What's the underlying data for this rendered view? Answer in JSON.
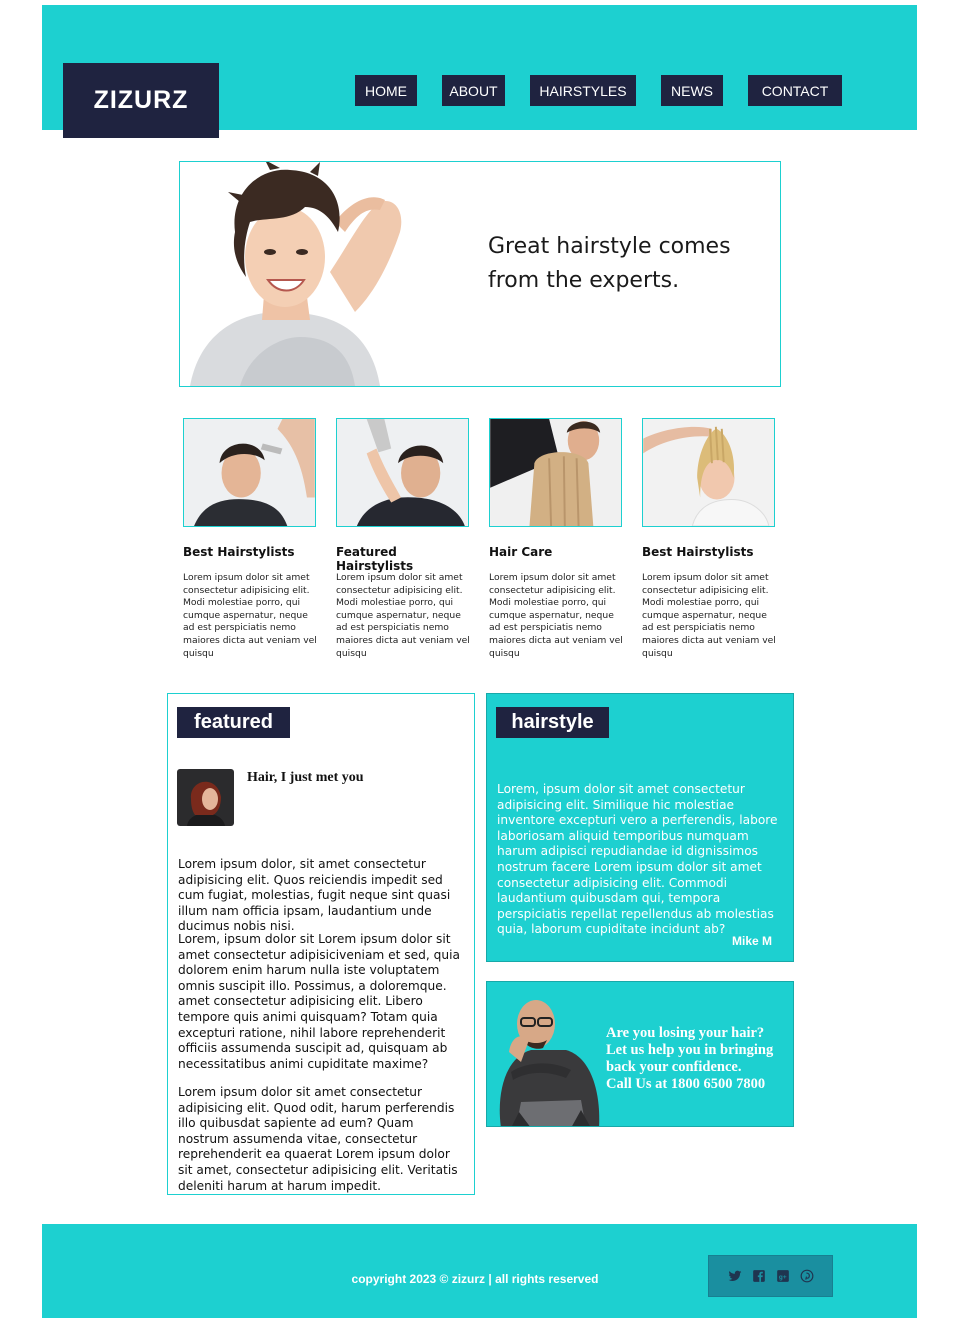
{
  "brand": {
    "logo": "ZIZURZ"
  },
  "nav": {
    "items": [
      {
        "label": "HOME"
      },
      {
        "label": "ABOUT"
      },
      {
        "label": "HAIRSTYLES"
      },
      {
        "label": "NEWS"
      },
      {
        "label": "CONTACT"
      }
    ]
  },
  "hero": {
    "line1": "Great hairstyle comes",
    "line2": "from the experts."
  },
  "cards": [
    {
      "title": "Best Hairstylists",
      "text": "Lorem ipsum dolor sit amet consectetur adipisicing elit. Modi molestiae porro, qui cumque aspernatur, neque ad est perspiciatis nemo maiores dicta aut veniam vel quisqu"
    },
    {
      "title": "Featured Hairstylists",
      "text": "Lorem ipsum dolor sit amet consectetur adipisicing elit. Modi molestiae porro, qui cumque aspernatur, neque ad est perspiciatis nemo maiores dicta aut veniam vel quisqu"
    },
    {
      "title": "Hair Care",
      "text": "Lorem ipsum dolor sit amet consectetur adipisicing elit. Modi molestiae porro, qui cumque aspernatur, neque ad est perspiciatis nemo maiores dicta aut veniam vel quisqu"
    },
    {
      "title": "Best Hairstylists",
      "text": "Lorem ipsum dolor sit amet consectetur adipisicing elit. Modi molestiae porro, qui cumque aspernatur, neque ad est perspiciatis nemo maiores dicta aut veniam vel quisqu"
    }
  ],
  "featured": {
    "tag": "featured",
    "heading": "Hair, I just met you",
    "paragraphs": [
      "Lorem ipsum dolor, sit amet consectetur adipisicing elit. Quos reiciendis impedit sed cum fugiat, molestias, fugit neque sint quasi illum nam officia ipsam, laudantium unde ducimus nobis nisi.",
      "Lorem, ipsum dolor sit Lorem ipsum dolor sit amet consectetur adipisiciveniam et sed, quia dolorem enim harum nulla iste voluptatem omnis suscipit illo. Possimus, a doloremque. amet consectetur adipisicing elit. Libero tempore quis animi quisquam? Totam quia excepturi ratione, nihil labore reprehenderit officiis assumenda suscipit ad, quisquam ab necessitatibus animi cupiditate maxime?",
      "Lorem ipsum dolor sit amet consectetur adipisicing elit. Quod odit, harum perferendis illo quibusdat sapiente ad eum? Quam nostrum assumenda vitae, consectetur reprehenderit ea quaerat Lorem ipsum dolor sit amet, consectetur adipisicing elit. Veritatis deleniti harum at harum impedit."
    ]
  },
  "hairstyle": {
    "tag": "hairstyle",
    "text": "Lorem, ipsum dolor sit amet consectetur adipisicing elit. Similique hic molestiae inventore excepturi vero a perferendis, labore laboriosam aliquid temporibus numquam harum adipisci repudiandae id dignissimos nostrum facere Lorem ipsum dolor sit amet consectetur adipisicing elit. Commodi laudantium quibusdam qui, tempora perspiciatis repellat repellendus ab molestias quia, laborum cupiditate incidunt ab?",
    "author": "Mike M"
  },
  "promo": {
    "line1": "Are you losing your hair?",
    "line2": "Let us help you in bringing",
    "line3": "back your confidence.",
    "line4": "Call Us at 1800 6500 7800"
  },
  "footer": {
    "copyright": "copyright 2023 © zizurz | all rights reserved",
    "social_icons": [
      "twitter-icon",
      "facebook-icon",
      "google-plus-icon",
      "pinterest-icon"
    ]
  },
  "colors": {
    "accent": "#1dd0d0",
    "dark": "#1f2340",
    "social_box": "#1a8fa0"
  }
}
